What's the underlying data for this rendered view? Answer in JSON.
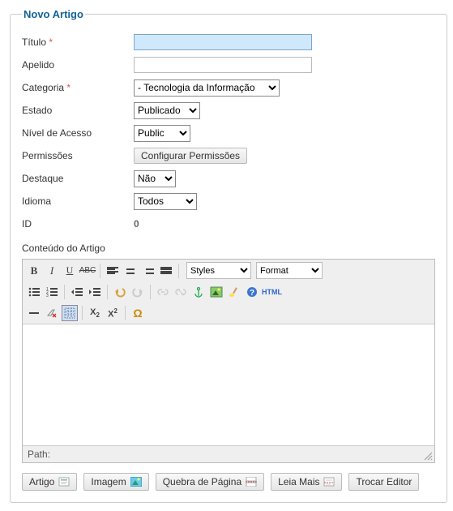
{
  "form": {
    "legend": "Novo Artigo",
    "title": {
      "label": "Título",
      "value": ""
    },
    "alias": {
      "label": "Apelido",
      "value": ""
    },
    "category": {
      "label": "Categoria",
      "selected": "- Tecnologia da Informação"
    },
    "state": {
      "label": "Estado",
      "selected": "Publicado"
    },
    "access": {
      "label": "Nível de Acesso",
      "selected": "Public"
    },
    "permissions": {
      "label": "Permissões",
      "button": "Configurar Permissões"
    },
    "featured": {
      "label": "Destaque",
      "selected": "Não"
    },
    "language": {
      "label": "Idioma",
      "selected": "Todos"
    },
    "id": {
      "label": "ID",
      "value": "0"
    },
    "content_label": "Conteúdo do Artigo"
  },
  "editor": {
    "styles_placeholder": "Styles",
    "format_placeholder": "Format",
    "html_label": "HTML",
    "path_label": "Path:"
  },
  "buttons": {
    "article": "Artigo",
    "image": "Imagem",
    "pagebreak": "Quebra de Página",
    "readmore": "Leia Mais",
    "toggle_editor": "Trocar Editor"
  }
}
